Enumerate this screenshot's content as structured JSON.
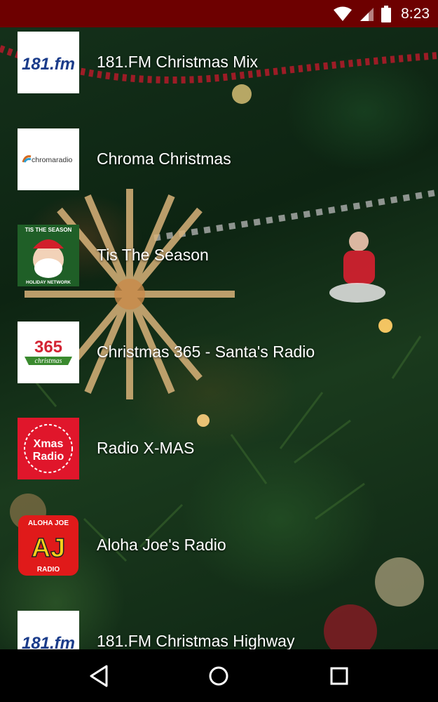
{
  "status_bar": {
    "time": "8:23",
    "icons": [
      "wifi-icon",
      "cell-signal-icon",
      "battery-icon"
    ],
    "color": "#6d0000"
  },
  "stations": [
    {
      "title": "181.FM Christmas Mix",
      "logo": "181fm-logo",
      "logo_text": "181.fm"
    },
    {
      "title": "Chroma Christmas",
      "logo": "chroma-radio-logo",
      "logo_text": "chromaradio"
    },
    {
      "title": "Tis The Season",
      "logo": "tis-the-season-logo",
      "logo_text": "TIS THE SEASON",
      "logo_subtext": "HOLIDAY NETWORK"
    },
    {
      "title": "Christmas 365 - Santa's Radio",
      "logo": "christmas-365-logo",
      "logo_text": "365",
      "logo_subtext": "christmas"
    },
    {
      "title": "Radio X-MAS",
      "logo": "xmas-radio-logo",
      "logo_text": "Xmas",
      "logo_subtext": "Radio"
    },
    {
      "title": "Aloha Joe's Radio",
      "logo": "aloha-joe-logo",
      "logo_text": "AJ",
      "logo_toptext": "ALOHA JOE",
      "logo_subtext": "RADIO"
    },
    {
      "title": "181.FM Christmas Highway",
      "logo": "181fm-logo",
      "logo_text": "181.fm"
    }
  ],
  "nav_bar": {
    "buttons": [
      "back-icon",
      "home-icon",
      "recents-icon"
    ]
  }
}
